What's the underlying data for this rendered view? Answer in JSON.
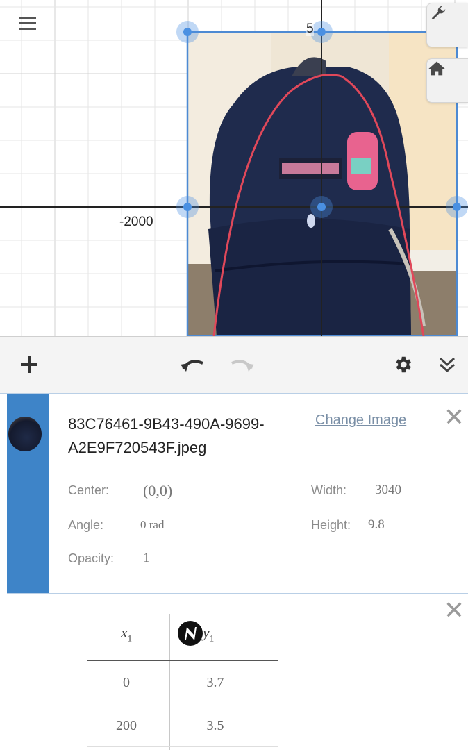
{
  "graph": {
    "tick_labels": {
      "x_neg": "-2000",
      "y_pos": "5"
    },
    "colors": {
      "grid_minor": "#e6e6e6",
      "grid_major": "#d0d0d0",
      "axis": "#222222",
      "image_border": "#4d8ad3",
      "handle": "#4a90e2",
      "curve": "#e0485a"
    },
    "icons": {
      "menu": "menu-icon",
      "settings_wrench": "wrench-icon",
      "home": "home-icon"
    }
  },
  "toolbar": {
    "icons": [
      "add-icon",
      "undo-icon",
      "redo-icon",
      "gear-icon",
      "collapse-icon"
    ]
  },
  "image_expression": {
    "filename": "83C76461-9B43-490A-9699-A2E9F720543F.jpeg",
    "change_label": "Change Image",
    "close_glyph": "✕",
    "props": {
      "center_label": "Center:",
      "center_value": "(0,0)",
      "width_label": "Width:",
      "width_value": "3040",
      "angle_label": "Angle:",
      "angle_value": "0 rad",
      "height_label": "Height:",
      "height_value": "9.8",
      "opacity_label": "Opacity:",
      "opacity_value": "1"
    },
    "colors": {
      "stripe": "#3e84c8"
    }
  },
  "table_expression": {
    "close_glyph": "✕",
    "header_x": "x",
    "header_x_sub": "1",
    "header_y": "y",
    "header_y_sub": "1",
    "rows": [
      {
        "x": "0",
        "y": "3.7"
      },
      {
        "x": "200",
        "y": "3.5"
      }
    ]
  }
}
